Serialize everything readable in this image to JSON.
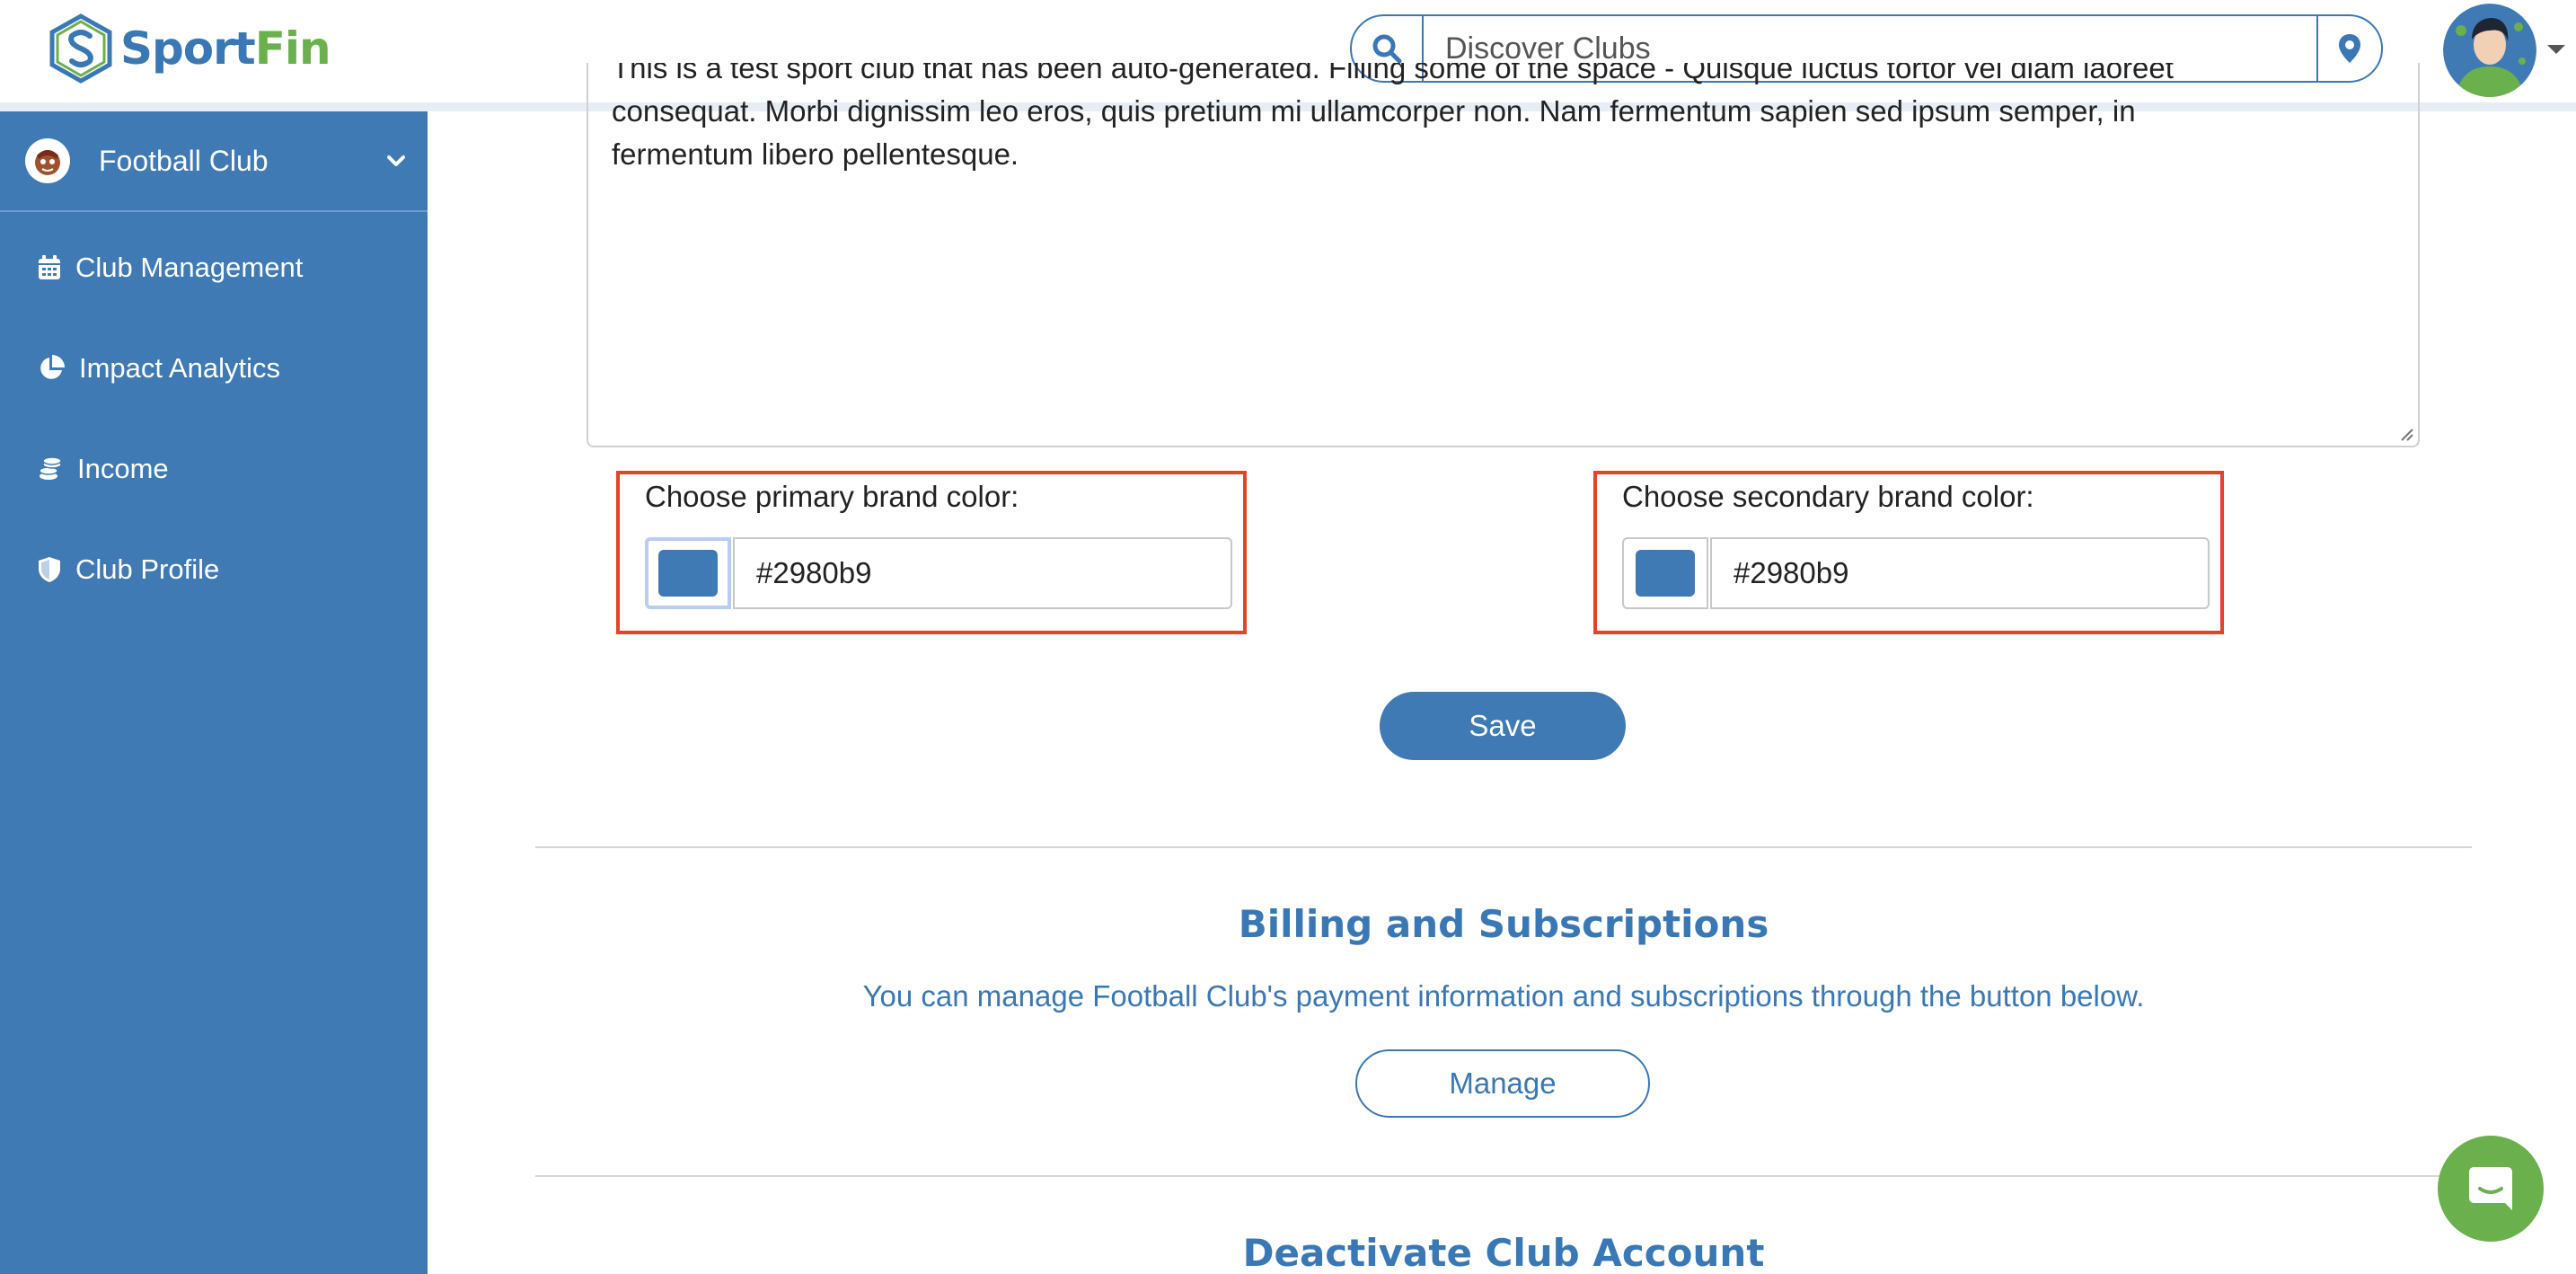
{
  "header": {
    "logo_sport": "Sport",
    "logo_fin": "Fin",
    "search_placeholder": "Discover Clubs",
    "icons": [
      "search-icon",
      "location-pin-icon",
      "avatar",
      "caret-down-icon"
    ]
  },
  "sidebar": {
    "club": {
      "label": "Football Club",
      "icon": "club-badge-icon"
    },
    "items": [
      {
        "label": "Club Management",
        "icon": "calendar-icon"
      },
      {
        "label": "Impact Analytics",
        "icon": "pie-chart-icon"
      },
      {
        "label": "Income",
        "icon": "coins-icon"
      },
      {
        "label": "Club Profile",
        "icon": "shield-icon"
      }
    ]
  },
  "main": {
    "description_lines": [
      "This is a test sport club that has been auto-generated. Filling some of the space - Quisque luctus tortor vel diam laoreet",
      "consequat. Morbi dignissim leo eros, quis pretium mi ullamcorper non. Nam fermentum sapien sed ipsum semper, in",
      "fermentum libero pellentesque."
    ],
    "primary_color": {
      "label": "Choose primary brand color:",
      "value": "#2980b9",
      "swatch": "#3f7ab5"
    },
    "secondary_color": {
      "label": "Choose secondary brand color:",
      "value": "#2980b9",
      "swatch": "#3f7ab5"
    },
    "save_label": "Save",
    "billing": {
      "title": "Billing and Subscriptions",
      "text": "You can manage Football Club's payment information and subscriptions through the button below.",
      "button_label": "Manage"
    },
    "deactivate": {
      "title": "Deactivate Club Account"
    }
  },
  "colors": {
    "brand_blue": "#3f7ab5",
    "brand_green": "#6ab04c",
    "highlight_red": "#e0452b"
  }
}
